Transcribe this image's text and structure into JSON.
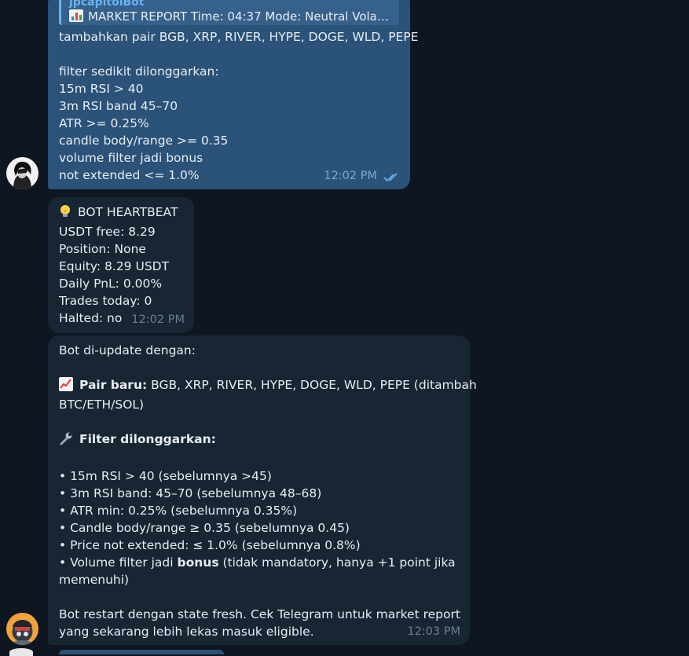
{
  "messages": {
    "outgoing": {
      "reply": {
        "sender": "jpcapitolBot",
        "icon": "bar-chart-icon",
        "text": "MARKET REPORT Time: 04:37 Mode: Neutral Volat..."
      },
      "lines": [
        "tambahkan pair BGB, XRP, RIVER, HYPE, DOGE, WLD, PEPE",
        "",
        "filter sedikit dilonggarkan:",
        "15m RSI > 40",
        "3m RSI band 45–70",
        "ATR >= 0.25%",
        "candle body/range >= 0.35",
        "volume filter jadi bonus",
        "not extended <= 1.0%"
      ],
      "time": "12:02 PM",
      "status_icon": "double-check-icon"
    },
    "heartbeat": {
      "icon": "light-bulb-icon",
      "title": "BOT HEARTBEAT",
      "lines": [
        "USDT free: 8.29",
        "Position: None",
        "Equity: 8.29 USDT",
        "Daily PnL: 0.00%",
        "Trades today: 0",
        "Halted: no"
      ],
      "time": "12:02 PM"
    },
    "update": {
      "intro": "Bot di-update dengan:",
      "pair_icon": "chart-increasing-icon",
      "pair_label": "Pair baru:",
      "pair_text_1": " BGB, XRP, RIVER, HYPE, DOGE, WLD, PEPE (ditambah",
      "pair_text_2": "BTC/ETH/SOL)",
      "filter_icon": "wrench-icon",
      "filter_label": "Filter dilonggarkan:",
      "bullets": [
        "• 15m RSI > 40 (sebelumnya >45)",
        "• 3m RSI band: 45–70 (sebelumnya 48–68)",
        "• ATR min: 0.25% (sebelumnya 0.35%)",
        "• Candle body/range ≥ 0.35 (sebelumnya 0.45)",
        "• Price not extended: ≤ 1.0% (sebelumnya 0.8%)"
      ],
      "volume_prefix": "• Volume filter jadi ",
      "volume_bold": "bonus",
      "volume_suffix": " (tidak mandatory, hanya +1 point jika",
      "volume_line2": "memenuhi)",
      "outro_1": "Bot restart dengan state fresh. Cek Telegram untuk market report",
      "outro_2": "yang sekarang lebih lekas masuk eligible.",
      "time": "12:03 PM"
    }
  },
  "colors": {
    "background": "#0e1621",
    "outgoing_bubble": "#2b5278",
    "incoming_bubble": "#182533",
    "accent": "#6ab3f3"
  }
}
